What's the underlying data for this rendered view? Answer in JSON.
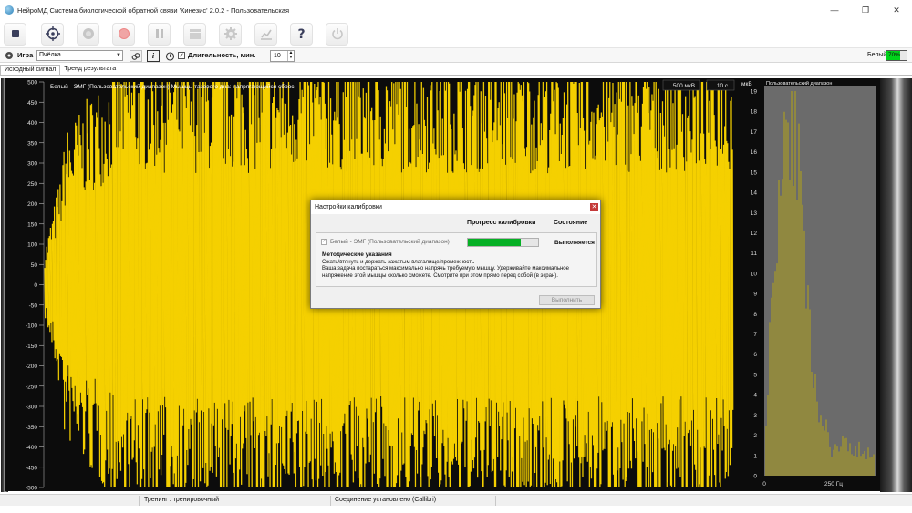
{
  "window": {
    "title": "НейроМД Система биологической обратной связи 'Кинезис' 2.0.2 - Пользовательская",
    "minimize": "—",
    "maximize": "❐",
    "close": "✕"
  },
  "toolbar": {
    "buttons": [
      "stop",
      "target",
      "circle-gray",
      "record",
      "pause",
      "stack",
      "gear",
      "chart",
      "help",
      "power"
    ]
  },
  "options": {
    "game_label": "Игра",
    "game_value": "Пчёлка",
    "duration_label": "Длительность, мин.",
    "duration_checked": "✓",
    "duration_value": "10",
    "channel_label": "Белый",
    "channel_percent": "70%"
  },
  "tabs": [
    {
      "label": "Исходный сигнал",
      "active": true
    },
    {
      "label": "Тренд результата",
      "active": false
    }
  ],
  "signal_chart": {
    "channel_caption": "Белый - ЭМГ (Пользовательский диапазон) Мышцы тазового дна: напрягающийся сброс",
    "scale_box": "500 мкВ",
    "time_box": "10 с",
    "y_ticks": [
      "500",
      "450",
      "400",
      "350",
      "300",
      "250",
      "200",
      "150",
      "100",
      "50",
      "0",
      "-50",
      "-100",
      "-150",
      "-200",
      "-250",
      "-300",
      "-350",
      "-400",
      "-450",
      "-500"
    ],
    "line_color": "#f5d000",
    "bg_color": "#0c0c0c"
  },
  "histogram": {
    "unit_label": "мкВ",
    "caption": "Пользовательский диапазон",
    "y_ticks": [
      "19",
      "18",
      "17",
      "16",
      "15",
      "14",
      "13",
      "12",
      "11",
      "10",
      "9",
      "8",
      "7",
      "6",
      "5",
      "4",
      "3",
      "2",
      "1",
      "0"
    ],
    "x_tick_0": "0",
    "x_tick_250": "250 Гц",
    "bar_color": "#c8b400"
  },
  "dialog": {
    "title": "Настройки калибровки",
    "close": "✕",
    "col_progress": "Прогресс калибровки",
    "col_state": "Состояние",
    "row_label": "Белый - ЭМГ (Пользовательский диапазон)",
    "row_state": "Выполняется",
    "progress": 0.75,
    "section_title": "Методические указания",
    "instruction_1": "Сжать/втянуть и держать зажатым влагалище/промежность",
    "instruction_2": "Ваша задача постараться максимально напрячь требуемую мышцу. Удерживайте максимальное напряжение этой мышцы сколько сможете. Смотрите при этом прямо перед собой (в экран).",
    "button": "Выполнить"
  },
  "status": {
    "training": "Тренинг : тренировочный",
    "connection": "Соединение установлено (Callibri)"
  }
}
